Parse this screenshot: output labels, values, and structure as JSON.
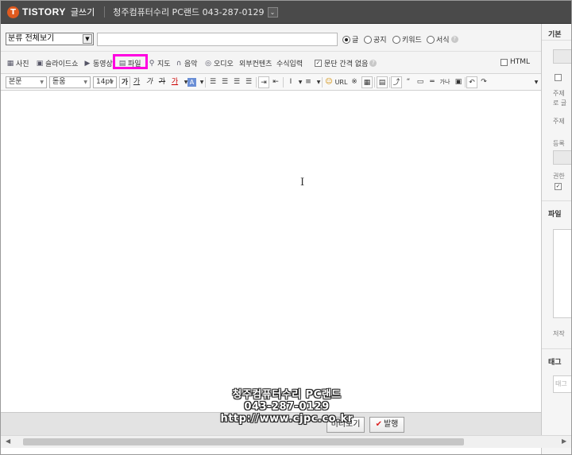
{
  "header": {
    "logo_letter": "T",
    "logo_text": "TISTORY",
    "mode_label": "글쓰기",
    "blog_name": "청주컴퓨터수리 PC랜드 043-287-0129",
    "blog_dropdown": "⌄"
  },
  "post_meta": {
    "category_selected": "분류 전체보기",
    "title_value": "",
    "types": [
      {
        "label": "글",
        "selected": true
      },
      {
        "label": "공지",
        "selected": false
      },
      {
        "label": "키워드",
        "selected": false
      },
      {
        "label": "서식",
        "selected": false
      }
    ]
  },
  "attach_toolbar": {
    "items": [
      "사진",
      "슬라이드쇼",
      "동영상",
      "파일",
      "지도",
      "음악",
      "오디오",
      "외부컨텐츠",
      "수식입력"
    ],
    "paragraph_option": "문단 간격 없음",
    "html_label": "HTML",
    "highlighted": "파일"
  },
  "format_toolbar": {
    "style_select": "본문",
    "font_select": "돋움",
    "size_select": "14pt",
    "bold": "가",
    "underline": "가",
    "italic": "가",
    "strike": "가",
    "font_color": "가",
    "url_label": "URL",
    "special_chars": "가나다"
  },
  "right_panel": {
    "section1": "기본",
    "text1": "주제",
    "text2": "로 글",
    "text3": "주제",
    "text4": "등록",
    "text5": "권한",
    "section2": "파일",
    "text6": "저작",
    "section3": "태그",
    "text7": "태그"
  },
  "footer": {
    "preview_label": "미리보기",
    "publish_label": "발행",
    "publish_check": "✔"
  },
  "watermark": {
    "line1": "청주컴퓨터수리 PC랜드",
    "line2": "043-287-0129",
    "line3": "http://www.cjpc.co.kr"
  }
}
